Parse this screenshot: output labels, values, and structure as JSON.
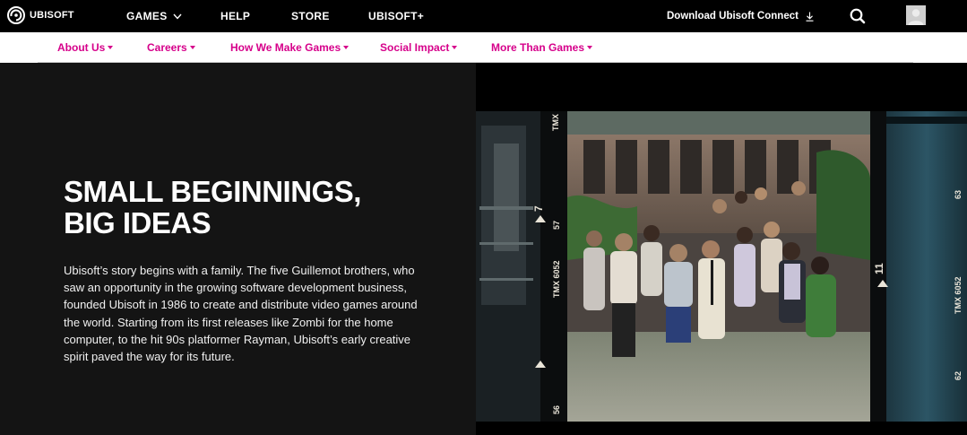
{
  "header": {
    "brand": "UBISOFT",
    "nav": [
      {
        "label": "GAMES",
        "has_dropdown": true
      },
      {
        "label": "HELP"
      },
      {
        "label": "STORE"
      },
      {
        "label": "UBISOFT+"
      }
    ],
    "download_label": "Download Ubisoft Connect",
    "icons": {
      "logo": "ubisoft-swirl-icon",
      "download": "download-icon",
      "search": "search-icon",
      "avatar": "user-avatar-icon"
    }
  },
  "subnav": {
    "items": [
      {
        "label": "About Us"
      },
      {
        "label": "Careers"
      },
      {
        "label": "How We Make Games"
      },
      {
        "label": "Social Impact"
      },
      {
        "label": "More Than Games"
      }
    ],
    "accent_color": "#d6008a"
  },
  "hero": {
    "headline_line1": "SMALL BEGINNINGS,",
    "headline_line2": "BIG IDEAS",
    "body": "Ubisoft’s story begins with a family. The five Guillemot brothers, who saw an opportunity in the growing software development business, founded Ubisoft in 1986 to create and distribute video games around the world. Starting from its first releases like Zombi for the home computer, to the hit 90s platformer Rayman, Ubisoft’s early creative spirit paved the way for its future.",
    "film_markings": {
      "left_top": "TMX",
      "left_frame": "7",
      "left_num": "57",
      "left_stock": "TMX 6052",
      "left_bottom": "56",
      "right_frame": "11",
      "right_stock": "TMX 6052",
      "right_top": "63",
      "right_bottom": "62"
    }
  }
}
